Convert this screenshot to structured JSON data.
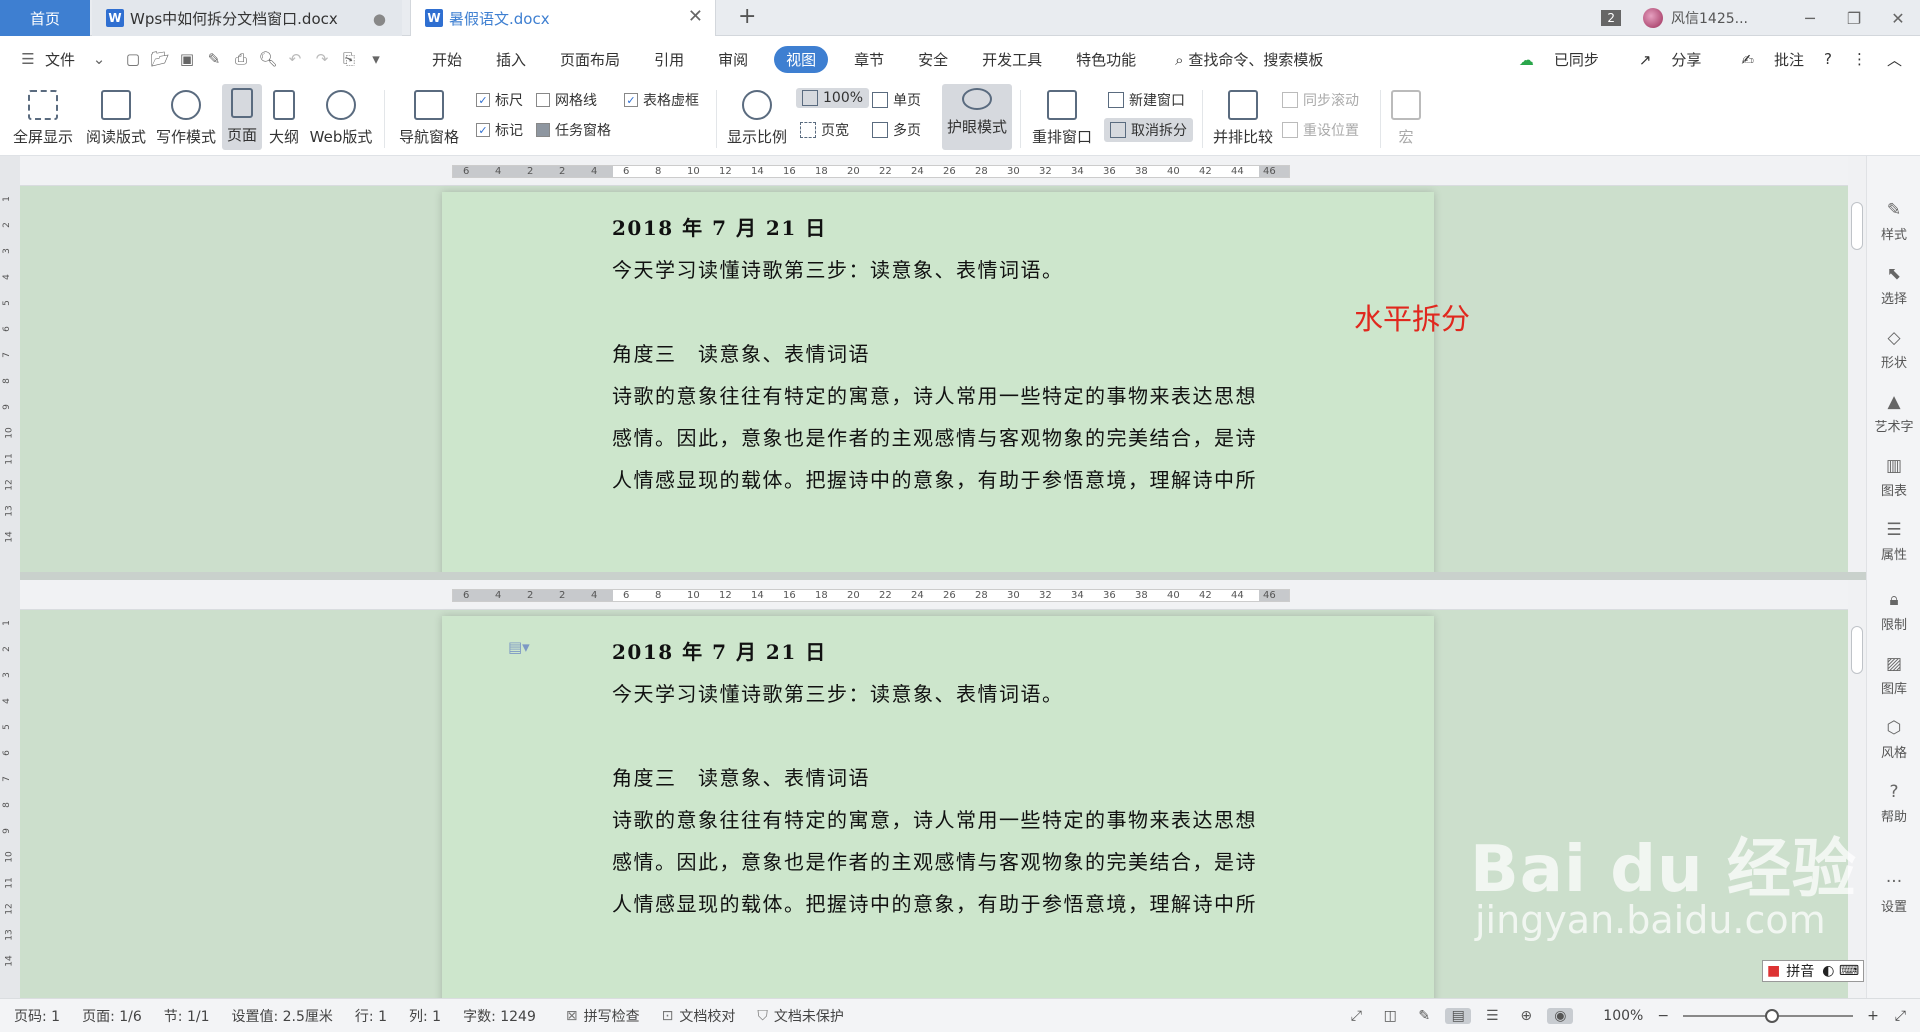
{
  "tabs": {
    "home": "首页",
    "doc1": "Wps中如何拆分文档窗口.docx",
    "doc2": "暑假语文.docx",
    "add": "+",
    "count_badge": "2",
    "user": "风信1425..."
  },
  "menu": {
    "file": "文件",
    "tabs": [
      "开始",
      "插入",
      "页面布局",
      "引用",
      "审阅",
      "视图",
      "章节",
      "安全",
      "开发工具",
      "特色功能"
    ],
    "active_tab": "视图",
    "search": "查找命令、搜索模板",
    "synced": "已同步",
    "share": "分享",
    "comment": "批注"
  },
  "ribbon": {
    "fullscreen": "全屏显示",
    "read_mode": "阅读版式",
    "write_mode": "写作模式",
    "page": "页面",
    "outline": "大纲",
    "web": "Web版式",
    "nav_pane": "导航窗格",
    "ruler": "标尺",
    "gridlines": "网格线",
    "table_gridlines": "表格虚框",
    "marks": "标记",
    "task_pane": "任务窗格",
    "zoom_ratio": "显示比例",
    "hundred": "100%",
    "single_page": "单页",
    "page_width": "页宽",
    "multi_page": "多页",
    "eye_care": "护眼模式",
    "rearrange": "重排窗口",
    "new_window": "新建窗口",
    "cancel_split": "取消拆分",
    "side_by_side": "并排比较",
    "sync_scroll": "同步滚动",
    "reset_position": "重设位置",
    "macro": "宏"
  },
  "ruler_ticks": [
    "6",
    "4",
    "2",
    "2",
    "4",
    "6",
    "8",
    "10",
    "12",
    "14",
    "16",
    "18",
    "20",
    "22",
    "24",
    "26",
    "28",
    "30",
    "32",
    "34",
    "36",
    "38",
    "40",
    "42",
    "44",
    "46"
  ],
  "vruler_ticks": [
    "1",
    "2",
    "3",
    "4",
    "5",
    "6",
    "7",
    "8",
    "9",
    "10",
    "11",
    "12",
    "13",
    "14"
  ],
  "document": {
    "date": "2018 年 7 月 21 日",
    "line1": "今天学习读懂诗歌第三步：读意象、表情词语。",
    "heading": "角度三　读意象、表情词语",
    "p1": "诗歌的意象往往有特定的寓意，诗人常用一些特定的事物来表达思想",
    "p2": "感情。因此，意象也是作者的主观感情与客观物象的完美结合，是诗",
    "p3": "人情感显现的载体。把握诗中的意象，有助于参悟意境，理解诗中所"
  },
  "annotation": "水平拆分",
  "sidebar": [
    "样式",
    "选择",
    "形状",
    "艺术字",
    "图表",
    "属性",
    "限制",
    "图库",
    "风格",
    "帮助",
    "设置"
  ],
  "status": {
    "page_code": "页码: 1",
    "page": "页面: 1/6",
    "section": "节: 1/1",
    "setting": "设置值: 2.5厘米",
    "row": "行: 1",
    "col": "列: 1",
    "words": "字数: 1249",
    "spell": "拼写检查",
    "proof": "文档校对",
    "protect": "文档未保护",
    "zoom": "100%"
  },
  "watermark": "Bai du 经验",
  "watermark_url": "jingyan.baidu.com",
  "ime": "拼音"
}
